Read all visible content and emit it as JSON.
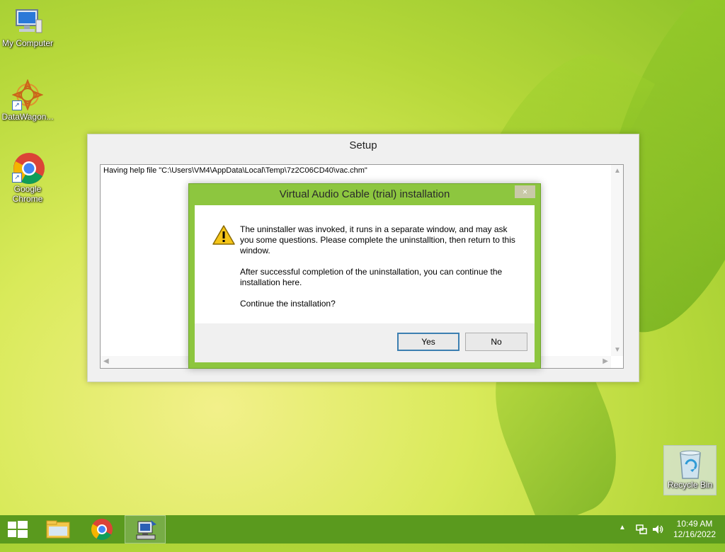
{
  "desktop": {
    "icons": [
      {
        "label": "My Computer"
      },
      {
        "label": "DataWagon..."
      },
      {
        "label": "Google Chrome"
      }
    ],
    "recycle_bin": {
      "label": "Recycle Bin"
    }
  },
  "setup_window": {
    "title": "Setup",
    "log_text": "Having help file \"C:\\Users\\VM4\\AppData\\Local\\Temp\\7z2C06CD40\\vac.chm\""
  },
  "dialog": {
    "title": "Virtual Audio Cable (trial) installation",
    "close_label": "×",
    "message_1": "The uninstaller was invoked, it runs in a separate window, and may ask you some questions. Please complete the uninstalltion, then return to this window.",
    "message_2": "After successful completion of the uninstallation, you can continue the installation here.",
    "message_3": "Continue the installation?",
    "yes_label": "Yes",
    "no_label": "No"
  },
  "taskbar": {
    "items": [
      "start-button",
      "file-explorer",
      "google-chrome",
      "setup-app"
    ],
    "time": "10:49 AM",
    "date": "12/16/2022"
  },
  "colors": {
    "taskbar": "#5a9a1e",
    "dialog_frame": "#8dc63f"
  }
}
